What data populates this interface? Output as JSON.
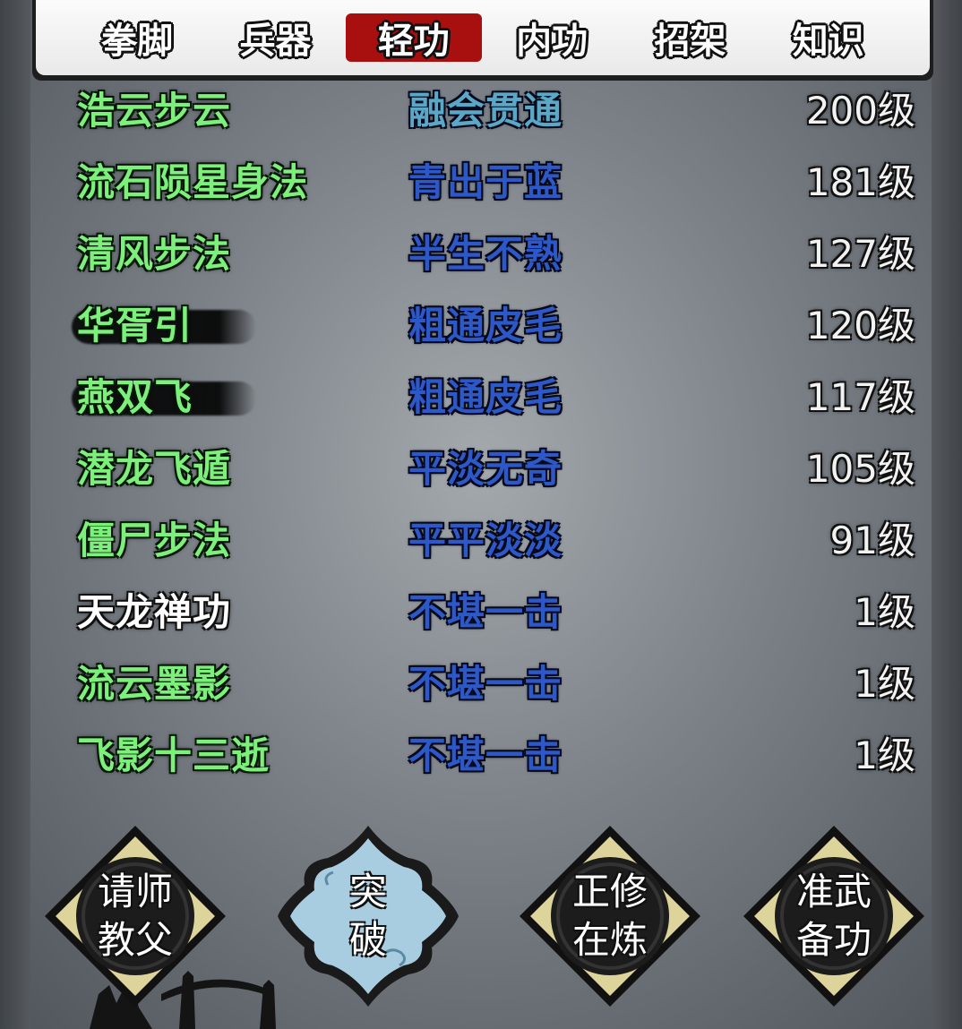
{
  "tabs": [
    {
      "label": "拳脚"
    },
    {
      "label": "兵器"
    },
    {
      "label": "轻功"
    },
    {
      "label": "内功"
    },
    {
      "label": "招架"
    },
    {
      "label": "知识"
    }
  ],
  "active_tab": "轻功",
  "skills": [
    {
      "name": "浩云步云",
      "rank": "融会贯通",
      "level": "200级",
      "name_color": "#7cf07a",
      "rank_color": "#5aa7c6"
    },
    {
      "name": "流石陨星身法",
      "rank": "青出于蓝",
      "level": "181级",
      "name_color": "#7cf07a",
      "rank_color": "#2d59c8"
    },
    {
      "name": "清风步法",
      "rank": "半生不熟",
      "level": "127级",
      "name_color": "#7cf07a",
      "rank_color": "#2d59c8"
    },
    {
      "name": "华胥引",
      "rank": "粗通皮毛",
      "level": "120级",
      "name_color": "#7cf07a",
      "rank_color": "#2d59c8"
    },
    {
      "name": "燕双飞",
      "rank": "粗通皮毛",
      "level": "117级",
      "name_color": "#7cf07a",
      "rank_color": "#2d59c8"
    },
    {
      "name": "潜龙飞遁",
      "rank": "平淡无奇",
      "level": "105级",
      "name_color": "#7cf07a",
      "rank_color": "#2d59c8"
    },
    {
      "name": "僵尸步法",
      "rank": "平平淡淡",
      "level": "91级",
      "name_color": "#7cf07a",
      "rank_color": "#2d59c8"
    },
    {
      "name": "天龙禅功",
      "rank": "不堪一击",
      "level": "1级",
      "name_color": "#ffffff",
      "rank_color": "#2d59c8"
    },
    {
      "name": "流云墨影",
      "rank": "不堪一击",
      "level": "1级",
      "name_color": "#7cf07a",
      "rank_color": "#2d59c8"
    },
    {
      "name": "飞影十三逝",
      "rank": "不堪一击",
      "level": "1级",
      "name_color": "#7cf07a",
      "rank_color": "#2d59c8"
    }
  ],
  "buttons": {
    "teacher": {
      "line1": "请师",
      "line2": "教父"
    },
    "breakthrough": {
      "line1": "突",
      "line2": "破"
    },
    "practicing": {
      "line1": "正修",
      "line2": "在炼"
    },
    "prepare": {
      "line1": "准武",
      "line2": "备功"
    }
  },
  "colors": {
    "active_tab": "#a80f0f",
    "diamond_fill": "#dcd49a",
    "breakthrough_fill": "#a9cde0"
  }
}
